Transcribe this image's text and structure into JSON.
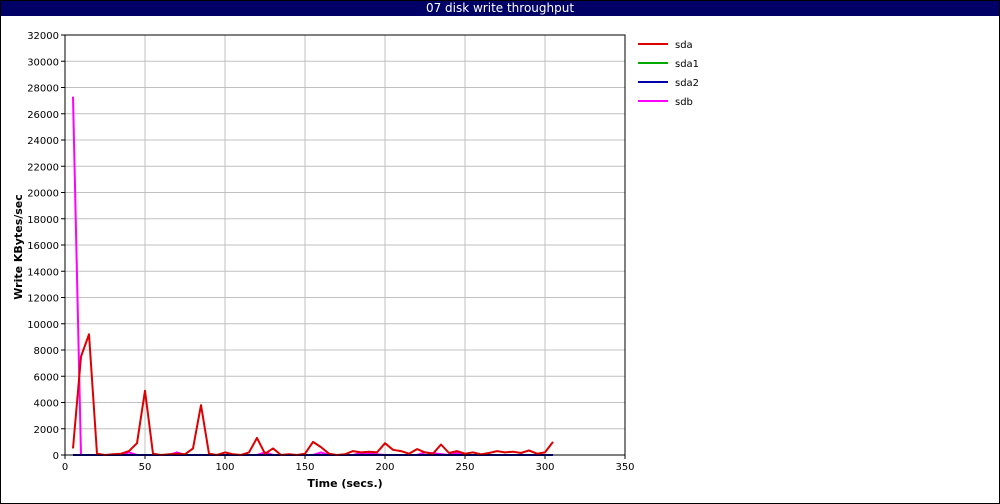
{
  "chart_data": {
    "type": "line",
    "title": "07 disk write throughput",
    "xlabel": "Time (secs.)",
    "ylabel": "Write KBytes/sec",
    "xlim": [
      0,
      350
    ],
    "ylim": [
      0,
      32000
    ],
    "xticks": [
      0,
      50,
      100,
      150,
      200,
      250,
      300,
      350
    ],
    "yticks": [
      0,
      2000,
      4000,
      6000,
      8000,
      10000,
      12000,
      14000,
      16000,
      18000,
      20000,
      22000,
      24000,
      26000,
      28000,
      30000,
      32000
    ],
    "grid": true,
    "legend_position": "right",
    "series": [
      {
        "name": "sda",
        "color": "#dd0000",
        "x": [
          5,
          10,
          15,
          20,
          25,
          30,
          35,
          40,
          45,
          50,
          55,
          60,
          65,
          70,
          75,
          80,
          85,
          90,
          95,
          100,
          105,
          110,
          115,
          120,
          125,
          130,
          135,
          140,
          145,
          150,
          155,
          160,
          165,
          170,
          175,
          180,
          185,
          190,
          195,
          200,
          205,
          210,
          215,
          220,
          225,
          230,
          235,
          240,
          245,
          250,
          255,
          260,
          265,
          270,
          275,
          280,
          285,
          290,
          295,
          300,
          305
        ],
        "values": [
          500,
          7500,
          9200,
          100,
          0,
          50,
          100,
          300,
          900,
          4900,
          100,
          0,
          50,
          100,
          50,
          500,
          3800,
          100,
          0,
          200,
          50,
          0,
          200,
          1300,
          100,
          500,
          0,
          50,
          0,
          100,
          1000,
          600,
          100,
          0,
          50,
          300,
          200,
          250,
          200,
          900,
          400,
          300,
          100,
          450,
          200,
          100,
          800,
          150,
          300,
          100,
          200,
          50,
          150,
          300,
          200,
          250,
          150,
          350,
          100,
          200,
          1000
        ]
      },
      {
        "name": "sda1",
        "color": "#00aa00",
        "x": [
          5,
          305
        ],
        "values": [
          0,
          0
        ]
      },
      {
        "name": "sda2",
        "color": "#0000aa",
        "x": [
          5,
          305
        ],
        "values": [
          0,
          0
        ]
      },
      {
        "name": "sdb",
        "color": "#ff00ff",
        "x": [
          5,
          10,
          15,
          20,
          35,
          40,
          45,
          65,
          70,
          75,
          120,
          125,
          130,
          155,
          160,
          165,
          180,
          185,
          200,
          220,
          225,
          240,
          245,
          250
        ],
        "values": [
          27300,
          0,
          0,
          0,
          0,
          200,
          0,
          0,
          200,
          0,
          0,
          200,
          0,
          0,
          200,
          0,
          0,
          150,
          0,
          0,
          200,
          0,
          150,
          0
        ]
      }
    ]
  }
}
